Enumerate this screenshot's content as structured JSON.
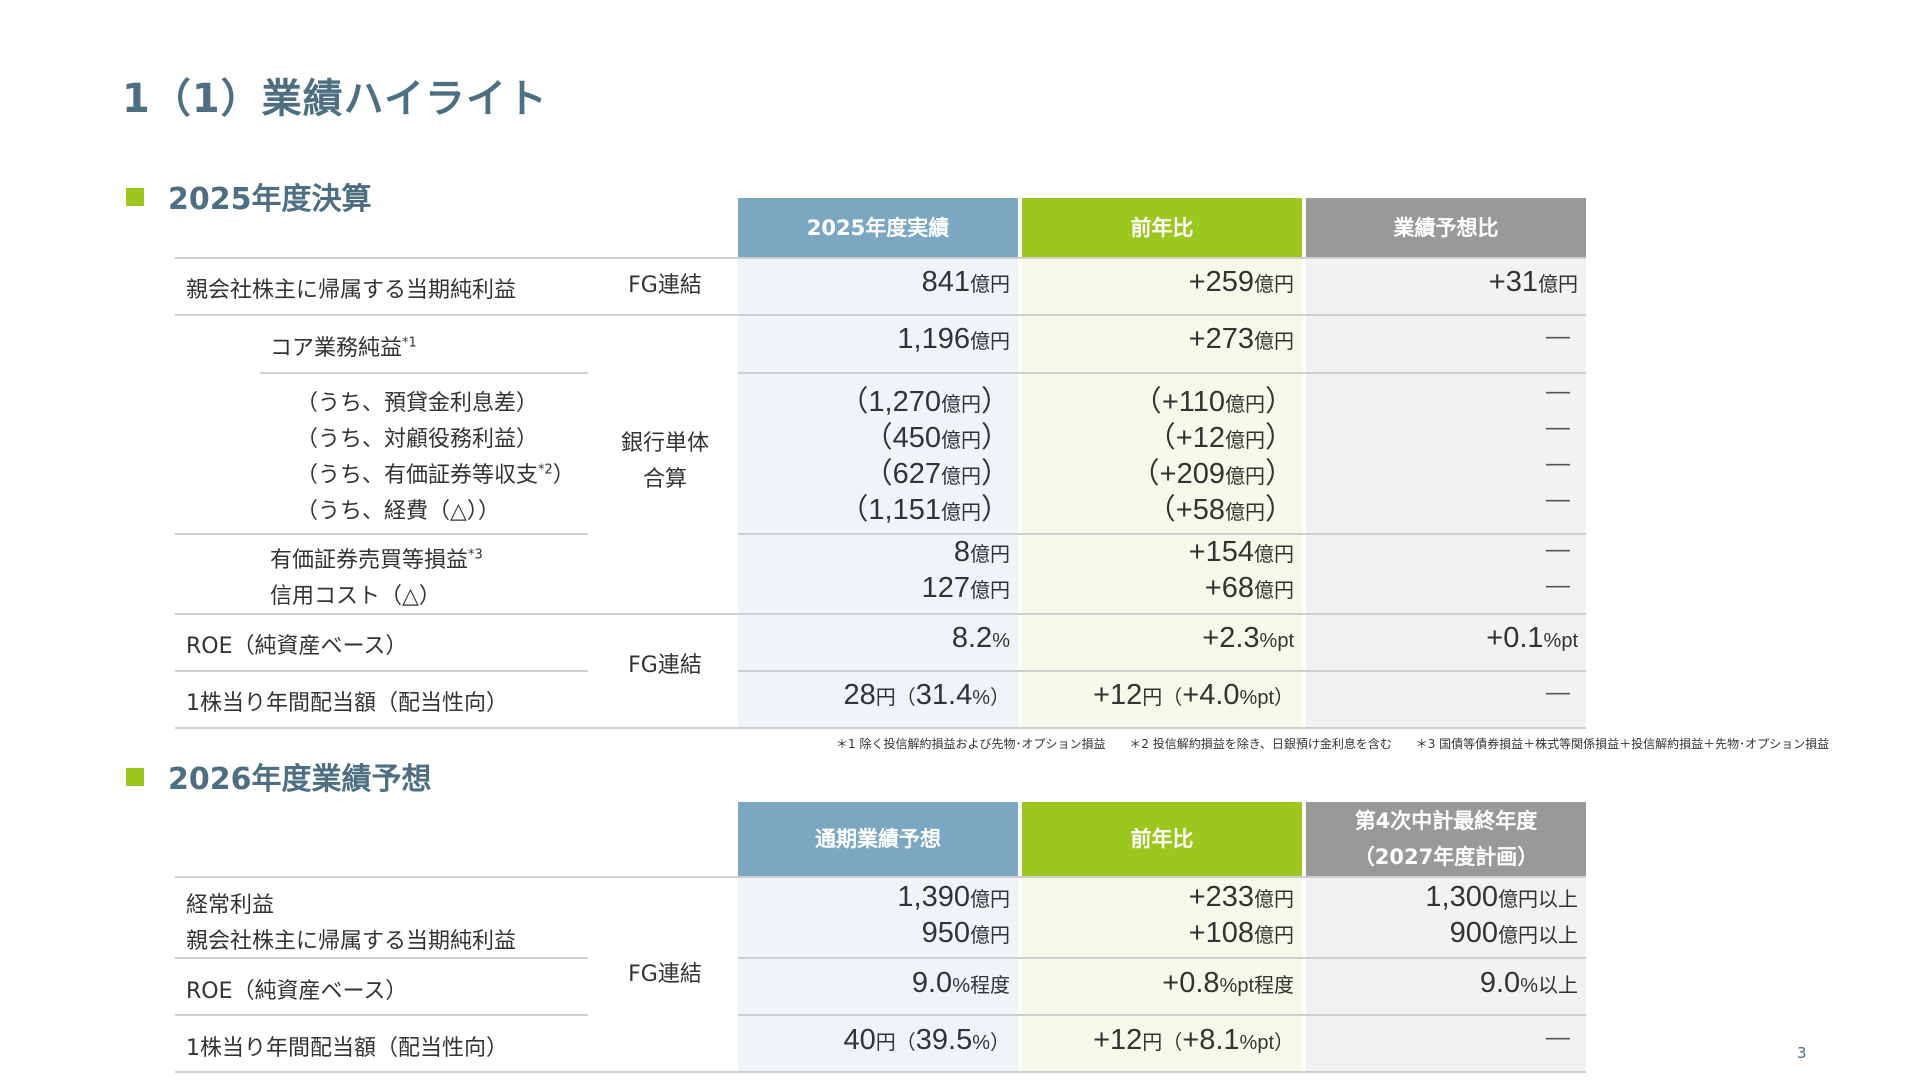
{
  "page_title": "1（1）業績ハイライト",
  "page_number": "3",
  "section1": {
    "heading": "2025年度決算",
    "headers": [
      "2025年度実績",
      "前年比",
      "業績予想比"
    ],
    "row_labels": {
      "net_income": "親会社株主に帰属する当期純利益",
      "core_net": "コア業務純益",
      "core_net_note": "*1",
      "deposit": "（うち、預貸金利息差）",
      "customer": "（うち、対顧役務利益）",
      "securities_pl": "（うち、有価証券等収支",
      "securities_pl_note": "*2",
      "securities_pl_close": "）",
      "expenses": "（うち、経費（△））",
      "securities_gain": "有価証券売買等損益",
      "securities_gain_note": "*3",
      "credit_cost": "信用コスト（△）",
      "roe": "ROE（純資産ベース）",
      "dividend": "1株当り年間配当額（配当性向）"
    },
    "scope": {
      "fg1": "FG連結",
      "bank_line1": "銀行単体",
      "bank_line2": "合算",
      "fg2": "FG連結"
    },
    "col_actual": {
      "net_income": [
        "",
        "841",
        "億円",
        ""
      ],
      "core_net": [
        "",
        "1,196",
        "億円",
        ""
      ],
      "deposit": [
        "（",
        "1,270",
        "億円",
        "）"
      ],
      "customer": [
        "（",
        "450",
        "億円",
        "）"
      ],
      "securities_pl": [
        "（",
        "627",
        "億円",
        "）"
      ],
      "expenses": [
        "（",
        "1,151",
        "億円",
        "）"
      ],
      "securities_gain": [
        "",
        "8",
        "億円",
        ""
      ],
      "credit_cost": [
        "",
        "127",
        "億円",
        ""
      ],
      "roe": [
        "",
        "8.2",
        "%",
        ""
      ],
      "dividend": [
        "28",
        "円（",
        "31.4",
        "%）"
      ]
    },
    "col_yoy": {
      "net_income": [
        "",
        "+259",
        "億円",
        ""
      ],
      "core_net": [
        "",
        "+273",
        "億円",
        ""
      ],
      "deposit": [
        "（",
        "+110",
        "億円",
        "）"
      ],
      "customer": [
        "（",
        "+12",
        "億円",
        "）"
      ],
      "securities_pl": [
        "（",
        "+209",
        "億円",
        "）"
      ],
      "expenses": [
        "（",
        "+58",
        "億円",
        "）"
      ],
      "securities_gain": [
        "",
        "+154",
        "億円",
        ""
      ],
      "credit_cost": [
        "",
        "+68",
        "億円",
        ""
      ],
      "roe": [
        "",
        "+2.3",
        "%pt",
        ""
      ],
      "dividend": [
        "+12",
        "円（",
        "+4.0",
        "%pt）"
      ]
    },
    "col_forecast": {
      "net_income": [
        "+31",
        "億円"
      ],
      "core_net": "―",
      "deposit": "―",
      "customer": "―",
      "securities_pl": "―",
      "expenses": "―",
      "securities_gain": "―",
      "credit_cost": "―",
      "roe": [
        "+0.1",
        "%pt"
      ],
      "dividend": "―"
    },
    "footnotes": [
      "＊1 除く投信解約損益および先物･オプション損益",
      "＊2 投信解約損益を除き、日銀預け金利息を含む",
      "＊3 国債等債券損益＋株式等関係損益＋投信解約損益＋先物･オプション損益"
    ]
  },
  "section2": {
    "heading": "2026年度業績予想",
    "headers": [
      "通期業績予想",
      "前年比",
      "第4次中計最終年度",
      "（2027年度計画）"
    ],
    "row_labels": {
      "ordinary": "経常利益",
      "net_income": "親会社株主に帰属する当期純利益",
      "roe": "ROE（純資産ベース）",
      "dividend": "1株当り年間配当額（配当性向）"
    },
    "scope": "FG連結",
    "col_forecast": {
      "ordinary": [
        "1,390",
        "億円"
      ],
      "net_income": [
        "950",
        "億円"
      ],
      "roe": [
        "9.0",
        "%程度"
      ],
      "dividend": [
        "40",
        "円（",
        "39.5",
        "%）"
      ]
    },
    "col_yoy": {
      "ordinary": [
        "+233",
        "億円"
      ],
      "net_income": [
        "+108",
        "億円"
      ],
      "roe": [
        "+0.8",
        "%pt程度"
      ],
      "dividend": [
        "+12",
        "円（",
        "+8.1",
        "%pt）"
      ]
    },
    "col_plan": {
      "ordinary": [
        "1,300",
        "億円以上"
      ],
      "net_income": [
        "900",
        "億円以上"
      ],
      "roe": [
        "9.0",
        "%以上"
      ],
      "dividend": "―"
    }
  }
}
